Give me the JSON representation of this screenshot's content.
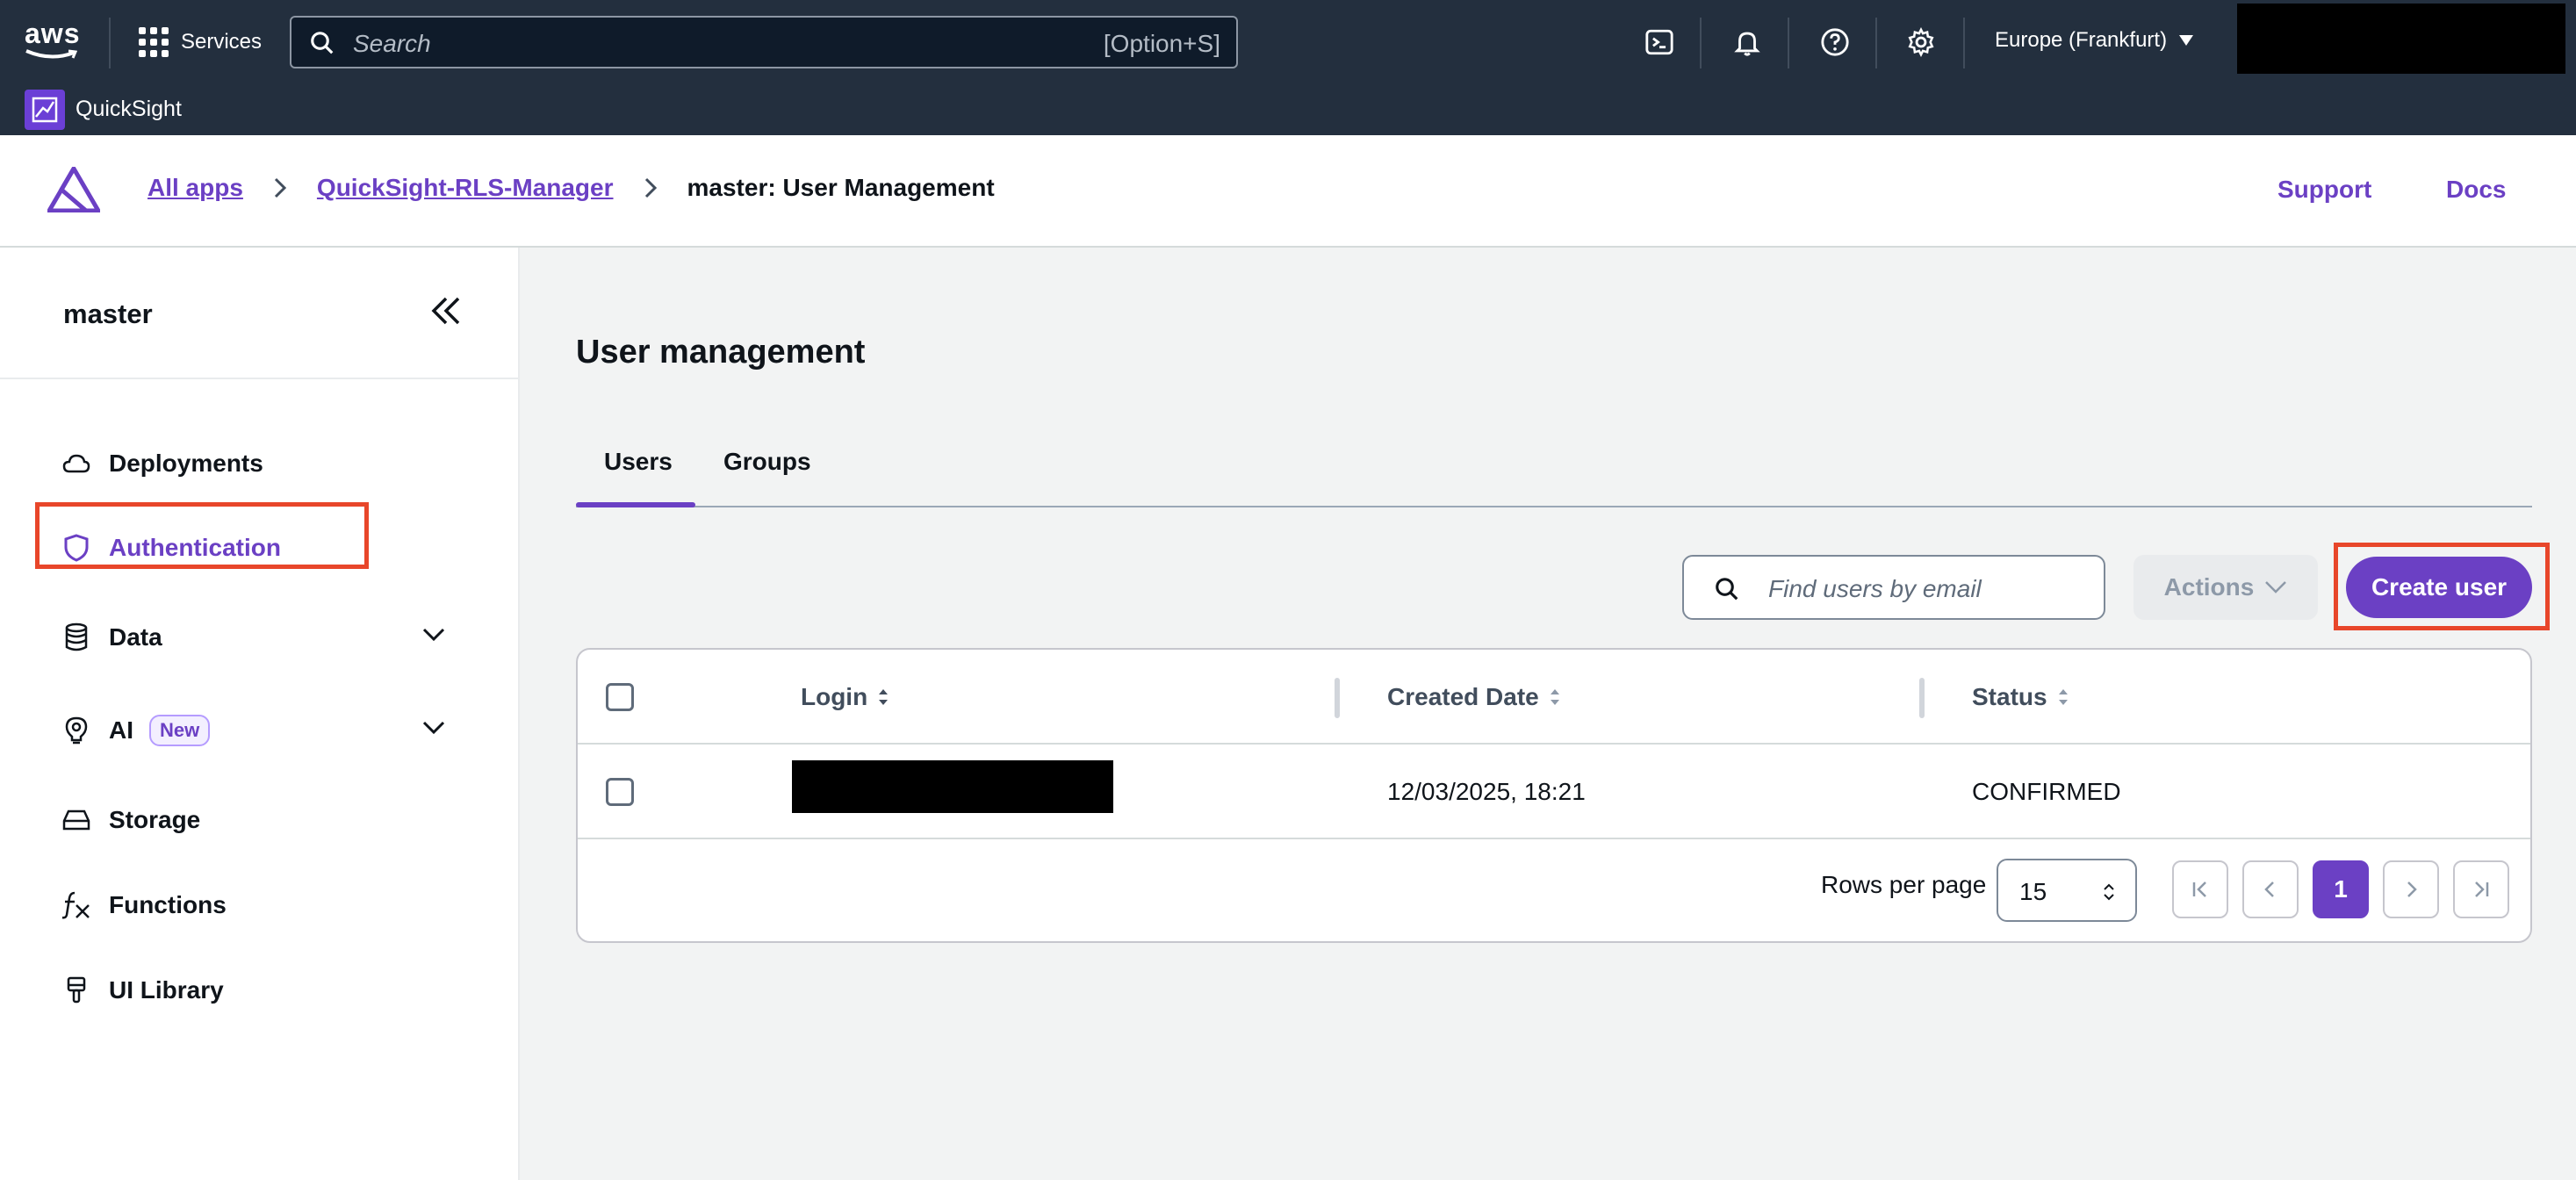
{
  "top_nav": {
    "brand": "aws",
    "services_label": "Services",
    "search_placeholder": "Search",
    "search_shortcut": "[Option+S]",
    "region": "Europe (Frankfurt)"
  },
  "service_bar": {
    "name": "QuickSight"
  },
  "header": {
    "breadcrumbs": [
      "All apps",
      "QuickSight-RLS-Manager",
      "master: User Management"
    ],
    "links": [
      "Support",
      "Docs"
    ]
  },
  "sidebar": {
    "title": "master",
    "items": [
      {
        "label": "Deployments",
        "icon": "cloud-icon"
      },
      {
        "label": "Authentication",
        "icon": "shield-icon",
        "active": true
      },
      {
        "label": "Data",
        "icon": "database-icon",
        "expandable": true
      },
      {
        "label": "AI",
        "icon": "lightbulb-icon",
        "badge": "New",
        "expandable": true
      },
      {
        "label": "Storage",
        "icon": "storage-icon"
      },
      {
        "label": "Functions",
        "icon": "function-icon"
      },
      {
        "label": "UI Library",
        "icon": "brush-icon"
      }
    ]
  },
  "main": {
    "title": "User management",
    "tabs": [
      {
        "label": "Users",
        "active": true
      },
      {
        "label": "Groups"
      }
    ],
    "search_placeholder": "Find users by email",
    "actions_label": "Actions",
    "create_label": "Create user",
    "table": {
      "columns": [
        "Login",
        "Created Date",
        "Status"
      ],
      "rows": [
        {
          "login": "",
          "created": "12/03/2025, 18:21",
          "status": "CONFIRMED"
        }
      ]
    },
    "pagination": {
      "rows_per_page_label": "Rows per page",
      "rows_per_page": "15",
      "current_page": "1"
    }
  },
  "colors": {
    "nav_bg": "#232f3e",
    "accent": "#6b40c4",
    "highlight": "#e8462a"
  }
}
